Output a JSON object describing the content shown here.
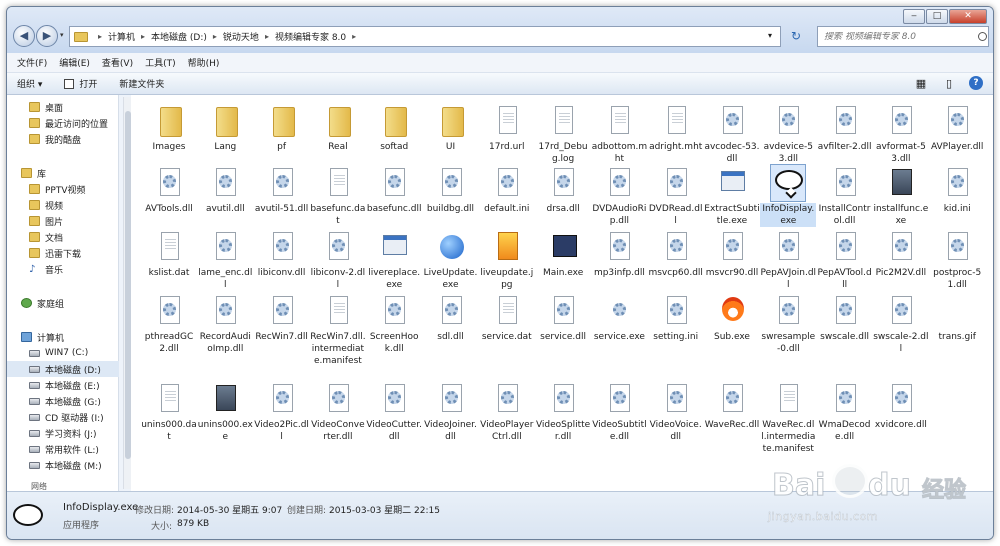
{
  "window": {
    "caption": {
      "minimize": "‒",
      "maximize": "□",
      "close": "✕"
    }
  },
  "address_bar": {
    "crumbs": [
      "计算机",
      "本地磁盘 (D:)",
      "锐动天地",
      "视频编辑专家 8.0"
    ]
  },
  "search": {
    "placeholder": "搜索 视频编辑专家 8.0"
  },
  "menu": [
    "文件(F)",
    "编辑(E)",
    "查看(V)",
    "工具(T)",
    "帮助(H)"
  ],
  "toolbar": {
    "organize": "组织 ▾",
    "open": "打开",
    "new_folder": "新建文件夹"
  },
  "sidebar": {
    "items": [
      {
        "label": "桌面",
        "icon": "folder"
      },
      {
        "label": "最近访问的位置",
        "icon": "folder"
      },
      {
        "label": "我的酷盘",
        "icon": "folder"
      },
      {
        "label": "库",
        "icon": "folder"
      },
      {
        "label": "PPTV视频",
        "icon": "folder"
      },
      {
        "label": "视频",
        "icon": "folder"
      },
      {
        "label": "图片",
        "icon": "folder"
      },
      {
        "label": "文档",
        "icon": "folder"
      },
      {
        "label": "迅雷下载",
        "icon": "folder"
      },
      {
        "label": "音乐",
        "icon": "music"
      },
      {
        "label": "家庭组",
        "icon": "homegroup"
      },
      {
        "label": "计算机",
        "icon": "computer"
      },
      {
        "label": "WIN7 (C:)",
        "icon": "drive"
      },
      {
        "label": "本地磁盘 (D:)",
        "icon": "drive",
        "selected": true
      },
      {
        "label": "本地磁盘 (E:)",
        "icon": "drive"
      },
      {
        "label": "本地磁盘 (G:)",
        "icon": "drive"
      },
      {
        "label": "CD 驱动器 (I:)",
        "icon": "drive"
      },
      {
        "label": "学习资料 (J:)",
        "icon": "drive"
      },
      {
        "label": "常用软件 (L:)",
        "icon": "drive"
      },
      {
        "label": "本地磁盘 (M:)",
        "icon": "drive"
      }
    ],
    "partial_label": "网络"
  },
  "files": [
    {
      "name": "Images",
      "icon": "folder"
    },
    {
      "name": "Lang",
      "icon": "folder"
    },
    {
      "name": "pf",
      "icon": "folder"
    },
    {
      "name": "Real",
      "icon": "folder"
    },
    {
      "name": "softad",
      "icon": "folder"
    },
    {
      "name": "UI",
      "icon": "folder"
    },
    {
      "name": "17rd.url",
      "icon": "page"
    },
    {
      "name": "17rd_Debug.log",
      "icon": "page"
    },
    {
      "name": "adbottom.mht",
      "icon": "page"
    },
    {
      "name": "adright.mht",
      "icon": "page"
    },
    {
      "name": "avcodec-53.dll",
      "icon": "dll"
    },
    {
      "name": "avdevice-53.dll",
      "icon": "dll"
    },
    {
      "name": "avfilter-2.dll",
      "icon": "dll"
    },
    {
      "name": "avformat-53.dll",
      "icon": "dll"
    },
    {
      "name": "AVPlayer.dll",
      "icon": "dll"
    },
    {
      "name": "AVTools.dll",
      "icon": "dll"
    },
    {
      "name": "avutil.dll",
      "icon": "dll"
    },
    {
      "name": "avutil-51.dll",
      "icon": "dll"
    },
    {
      "name": "basefunc.dat",
      "icon": "page"
    },
    {
      "name": "basefunc.dll",
      "icon": "dll"
    },
    {
      "name": "buildbg.dll",
      "icon": "dll"
    },
    {
      "name": "default.ini",
      "icon": "dll"
    },
    {
      "name": "drsa.dll",
      "icon": "dll"
    },
    {
      "name": "DVDAudioRip.dll",
      "icon": "dll"
    },
    {
      "name": "DVDRead.dll",
      "icon": "dll"
    },
    {
      "name": "ExtractSubtitle.exe",
      "icon": "app"
    },
    {
      "name": "InfoDisplay.exe",
      "icon": "bubble",
      "selected": true
    },
    {
      "name": "InstallControl.dll",
      "icon": "dll"
    },
    {
      "name": "installfunc.exe",
      "icon": "install"
    },
    {
      "name": "kid.ini",
      "icon": "dll"
    },
    {
      "name": "kslist.dat",
      "icon": "page"
    },
    {
      "name": "lame_enc.dll",
      "icon": "dll"
    },
    {
      "name": "libiconv.dll",
      "icon": "dll"
    },
    {
      "name": "libiconv-2.dll",
      "icon": "dll"
    },
    {
      "name": "livereplace.exe",
      "icon": "app"
    },
    {
      "name": "LiveUpdate.exe",
      "icon": "globe"
    },
    {
      "name": "liveupdate.jpg",
      "icon": "photo"
    },
    {
      "name": "Main.exe",
      "icon": "clap"
    },
    {
      "name": "mp3infp.dll",
      "icon": "dll"
    },
    {
      "name": "msvcp60.dll",
      "icon": "dll"
    },
    {
      "name": "msvcr90.dll",
      "icon": "dll"
    },
    {
      "name": "PepAVJoin.dll",
      "icon": "dll"
    },
    {
      "name": "PepAVTool.dll",
      "icon": "dll"
    },
    {
      "name": "Pic2M2V.dll",
      "icon": "dll"
    },
    {
      "name": "postproc-51.dll",
      "icon": "dll"
    },
    {
      "name": "pthreadGC2.dll",
      "icon": "dll"
    },
    {
      "name": "RecordAudioImp.dll",
      "icon": "dll"
    },
    {
      "name": "RecWin7.dll",
      "icon": "dll"
    },
    {
      "name": "RecWin7.dll.intermediate.manifest",
      "icon": "page"
    },
    {
      "name": "ScreenHook.dll",
      "icon": "dll"
    },
    {
      "name": "sdl.dll",
      "icon": "dll"
    },
    {
      "name": "service.dat",
      "icon": "page"
    },
    {
      "name": "service.dll",
      "icon": "dll"
    },
    {
      "name": "service.exe",
      "icon": "gear"
    },
    {
      "name": "setting.ini",
      "icon": "dll"
    },
    {
      "name": "Sub.exe",
      "icon": "flame"
    },
    {
      "name": "swresample-0.dll",
      "icon": "dll"
    },
    {
      "name": "swscale.dll",
      "icon": "dll"
    },
    {
      "name": "swscale-2.dll",
      "icon": "dll"
    },
    {
      "name": "trans.gif",
      "icon": "empty"
    },
    {
      "name": "unins000.dat",
      "icon": "page"
    },
    {
      "name": "unins000.exe",
      "icon": "install"
    },
    {
      "name": "Video2Pic.dll",
      "icon": "dll"
    },
    {
      "name": "VideoConverter.dll",
      "icon": "dll"
    },
    {
      "name": "VideoCutter.dll",
      "icon": "dll"
    },
    {
      "name": "VideoJoiner.dll",
      "icon": "dll"
    },
    {
      "name": "VideoPlayerCtrl.dll",
      "icon": "dll"
    },
    {
      "name": "VideoSplitter.dll",
      "icon": "dll"
    },
    {
      "name": "VideoSubtitle.dll",
      "icon": "dll"
    },
    {
      "name": "VideoVoice.dll",
      "icon": "dll"
    },
    {
      "name": "WaveRec.dll",
      "icon": "dll"
    },
    {
      "name": "WaveRec.dll.intermediate.manifest",
      "icon": "page"
    },
    {
      "name": "WmaDecode.dll",
      "icon": "dll"
    },
    {
      "name": "xvidcore.dll",
      "icon": "dll"
    }
  ],
  "status": {
    "name": "InfoDisplay.exe",
    "kind": "应用程序",
    "modified_label": "修改日期:",
    "modified_value": "2014-05-30 星期五 9:07",
    "created_label": "创建日期:",
    "created_value": "2015-03-03 星期二 22:15",
    "size_label": "大小:",
    "size_value": "879 KB"
  },
  "watermark": {
    "brand_a": "Bai",
    "brand_b": "du",
    "brand_c": "经验",
    "url": "jingyan.baidu.com"
  }
}
